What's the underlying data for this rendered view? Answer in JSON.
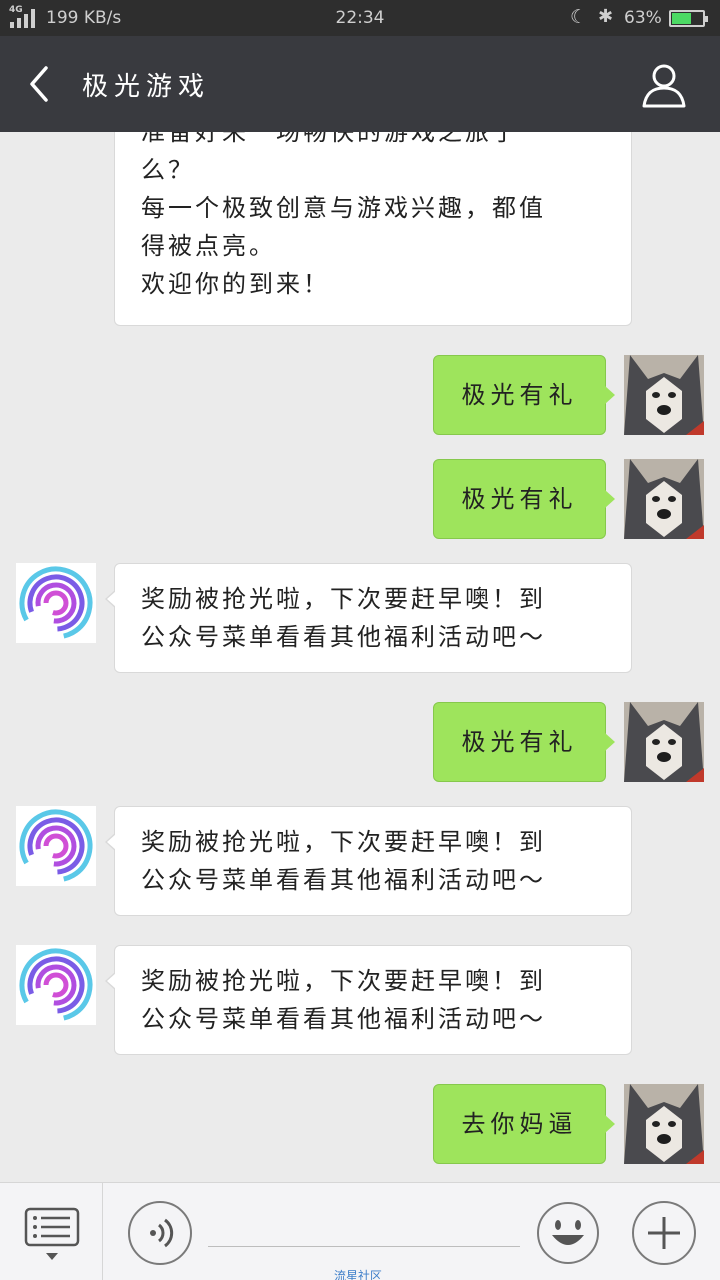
{
  "status_bar": {
    "network": "4G",
    "data_rate": "199  KB/s",
    "time": "22:34",
    "battery_percent": "63%",
    "battery_level": 0.63
  },
  "header": {
    "title": "极光游戏"
  },
  "messages": [
    {
      "from": "official",
      "lines": [
        "准备好来一场畅快的游戏之旅了",
        "么？",
        "每一个极致创意与游戏兴趣，都值",
        "得被点亮。",
        "欢迎你的到来！"
      ]
    },
    {
      "from": "user",
      "text": "极光有礼"
    },
    {
      "from": "user",
      "text": "极光有礼"
    },
    {
      "from": "official",
      "lines": [
        "奖励被抢光啦，下次要赶早噢！到",
        "公众号菜单看看其他福利活动吧～"
      ]
    },
    {
      "from": "user",
      "text": "极光有礼"
    },
    {
      "from": "official",
      "lines": [
        "奖励被抢光啦，下次要赶早噢！到",
        "公众号菜单看看其他福利活动吧～"
      ]
    },
    {
      "from": "official",
      "lines": [
        "奖励被抢光啦，下次要赶早噢！到",
        "公众号菜单看看其他福利活动吧～"
      ]
    },
    {
      "from": "user",
      "text": "去你妈逼"
    }
  ],
  "input_bar": {
    "watermark": "流星社区"
  },
  "colors": {
    "header_bg": "#393a3f",
    "status_bg": "#2e2e2e",
    "chat_bg": "#ebebeb",
    "outgoing_bubble": "#9ee45c",
    "incoming_bubble": "#ffffff"
  }
}
